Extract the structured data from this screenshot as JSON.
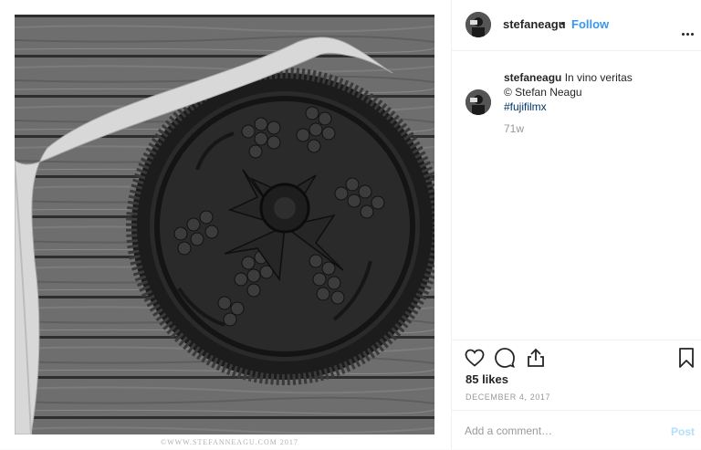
{
  "post": {
    "watermark": "©WWW.STEFANNEAGU.COM 2017"
  },
  "header": {
    "username": "stefaneagu",
    "separator": "•",
    "follow_label": "Follow",
    "more_icon": "more-horizontal-icon"
  },
  "caption": {
    "username": "stefaneagu",
    "line1": "In vino veritas",
    "line2": "© Stefan Neagu",
    "hashtag": "#fujifilmx",
    "age": "71w"
  },
  "actions": {
    "icons": [
      "heart-icon",
      "comment-icon",
      "share-icon",
      "bookmark-icon"
    ],
    "likes": "85 likes",
    "date": "DECEMBER 4, 2017"
  },
  "comment": {
    "placeholder": "Add a comment…",
    "post_label": "Post"
  },
  "colors": {
    "accent": "#3897f0",
    "post_disabled": "#b2dffc",
    "muted": "#999999",
    "text": "#262626"
  }
}
